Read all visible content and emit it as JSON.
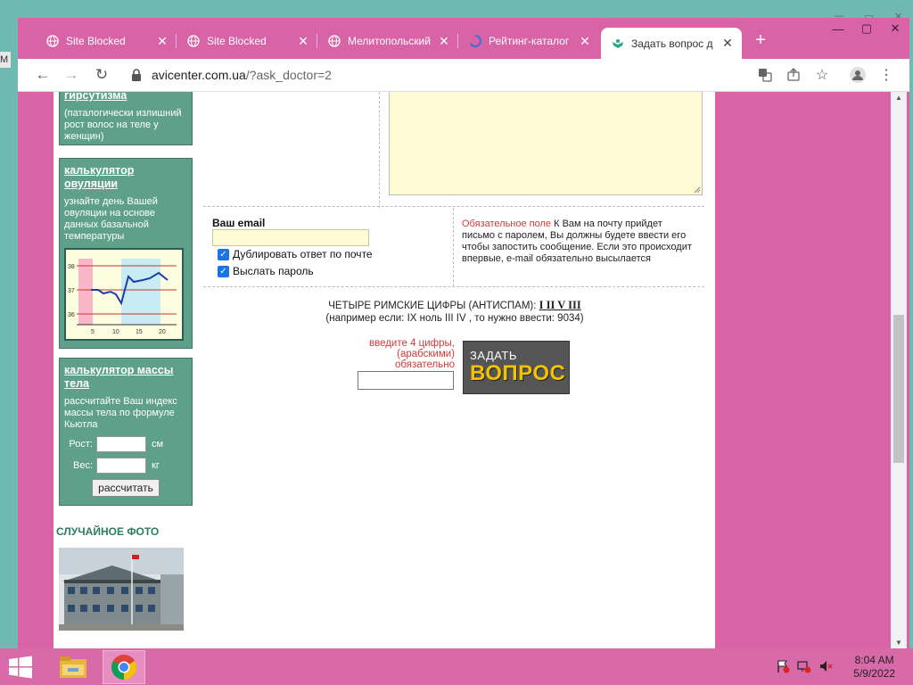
{
  "desktop": {
    "left_fragment": "M"
  },
  "browser": {
    "tabs": [
      {
        "title": "Site Blocked",
        "favicon": "globe-icon"
      },
      {
        "title": "Site Blocked",
        "favicon": "globe-icon"
      },
      {
        "title": "Мелитопольский",
        "favicon": "globe-icon"
      },
      {
        "title": "Рейтинг-каталог",
        "favicon": "loading-icon"
      },
      {
        "title": "Задать вопрос д",
        "favicon": "site-icon",
        "active": true
      }
    ],
    "url_host": "avicenter.com.ua",
    "url_path": "/?ask_doctor=2"
  },
  "sidebar": {
    "box1": {
      "link_fragment": "гирсутизма",
      "desc": "(паталогически излишний рост волос на теле у женщин)"
    },
    "box2": {
      "link": "калькулятор овуляции",
      "desc": "узнайте день Вашей овуляции на основе данных базальной температуры",
      "chart_ticks_y": [
        "38",
        "37",
        "36"
      ],
      "chart_ticks_x": [
        "5",
        "10",
        "15",
        "20"
      ]
    },
    "box3": {
      "link": "калькулятор массы тела",
      "desc": "рассчитайте Ваш индекс массы тела по формуле Кьютла",
      "height_label": "Рост:",
      "height_unit": "см",
      "weight_label": "Вес:",
      "weight_unit": "кг",
      "button": "рассчитать"
    },
    "random_photo_title": "СЛУЧАЙНОЕ ФОТО"
  },
  "form": {
    "email_label": "Ваш email",
    "dup_label": "Дублировать ответ по почте",
    "send_pw_label": "Выслать пароль",
    "required_label": "Обязательное поле",
    "note_text": " К Вам на почту прийдет письмо с паролем, Вы должны будете ввести его чтобы запостить сообщение. Если это происходит впервые, e-mail обязательно высылается",
    "antispam_prefix": "ЧЕТЫРЕ РИМСКИЕ ЦИФРЫ (АНТИСПАМ):",
    "antispam_code": "I II V III",
    "antispam_example": "(например если: IX ноль III IV , то нужно ввести: 9034)",
    "digits_note_1": "введите 4 цифры,",
    "digits_note_2": "(арабскими)",
    "digits_note_3": "обязательно",
    "ask_small": "ЗАДАТЬ",
    "ask_big": "ВОПРОС"
  },
  "taskbar": {
    "time": "8:04 AM",
    "date": "5/9/2022"
  }
}
